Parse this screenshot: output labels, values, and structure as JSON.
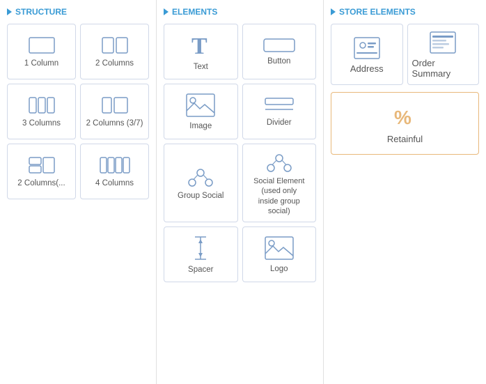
{
  "structure": {
    "header": "STRUCTURE",
    "items": [
      {
        "id": "1col",
        "label": "1 Column"
      },
      {
        "id": "2col",
        "label": "2 Columns"
      },
      {
        "id": "3col",
        "label": "3 Columns"
      },
      {
        "id": "2col37",
        "label": "2 Columns (3/7)"
      },
      {
        "id": "2colstack",
        "label": "2 Columns(..."
      },
      {
        "id": "4col",
        "label": "4 Columns"
      }
    ]
  },
  "elements": {
    "header": "ELEMENTS",
    "items": [
      {
        "id": "text",
        "label": "Text"
      },
      {
        "id": "button",
        "label": "Button"
      },
      {
        "id": "image",
        "label": "Image"
      },
      {
        "id": "divider",
        "label": "Divider"
      },
      {
        "id": "groupsocial",
        "label": "Group Social"
      },
      {
        "id": "socialelement",
        "label": "Social Element\n(used only\ninside group\nsocial)"
      },
      {
        "id": "spacer",
        "label": "Spacer"
      },
      {
        "id": "logo",
        "label": "Logo"
      }
    ]
  },
  "store": {
    "header": "STORE ELEMENTS",
    "items": [
      {
        "id": "address",
        "label": "Address"
      },
      {
        "id": "ordersummary",
        "label": "Order Summary"
      },
      {
        "id": "retainful",
        "label": "Retainful"
      }
    ]
  }
}
